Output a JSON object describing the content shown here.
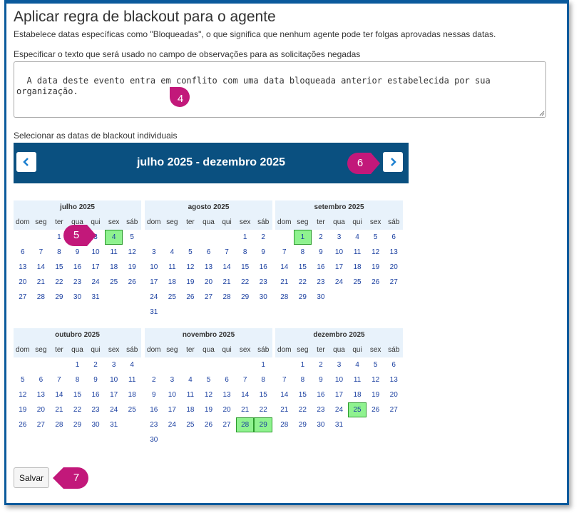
{
  "page": {
    "title": "Aplicar regra de blackout para o agente",
    "subtitle": "Estabelece datas específicas como \"Bloqueadas\", o que significa que nenhum agente pode ter folgas aprovadas nessas datas.",
    "notes_label": "Especificar o texto que será usado no campo de observações para as solicitações negadas",
    "notes_value": "A data deste evento entra em conflito com uma data bloqueada anterior estabelecida por sua\norganização.",
    "dates_label": "Selecionar as datas de blackout individuais",
    "range_label": "julho 2025 - dezembro 2025",
    "save_label": "Salvar"
  },
  "weekday_labels": [
    "dom",
    "seg",
    "ter",
    "qua",
    "qui",
    "sex",
    "sáb"
  ],
  "months": [
    {
      "name": "julho 2025",
      "offset": 2,
      "days": 31,
      "selected": [
        4
      ]
    },
    {
      "name": "agosto 2025",
      "offset": 5,
      "days": 31,
      "selected": []
    },
    {
      "name": "setembro 2025",
      "offset": 1,
      "days": 30,
      "selected": [
        1
      ]
    },
    {
      "name": "outubro 2025",
      "offset": 3,
      "days": 31,
      "selected": []
    },
    {
      "name": "novembro 2025",
      "offset": 6,
      "days": 30,
      "selected": [
        28,
        29
      ]
    },
    {
      "name": "dezembro 2025",
      "offset": 1,
      "days": 31,
      "selected": [
        25
      ]
    }
  ],
  "markers": [
    "4",
    "5",
    "6",
    "7"
  ],
  "colors": {
    "header_bg": "#0a5080",
    "selected_bg": "#8ff28f",
    "marker": "#c2187a",
    "border": "#0a5a9c"
  }
}
